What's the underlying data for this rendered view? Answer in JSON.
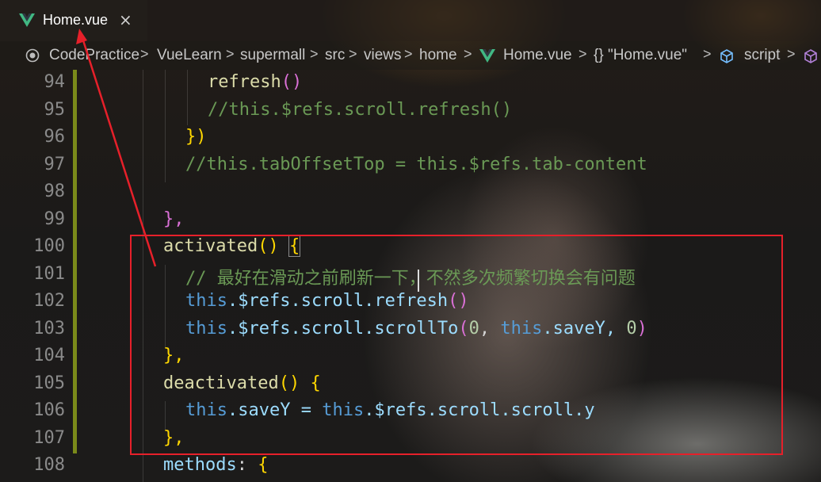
{
  "tab": {
    "name": "Home.vue",
    "close_glyph": "×",
    "icon": "vue-logo-icon"
  },
  "breadcrumb": {
    "items": [
      "CodePractice",
      "VueLearn",
      "supermall",
      "src",
      "views",
      "home",
      "Home.vue",
      "{} \"Home.vue\"",
      "script"
    ],
    "separator": ">"
  },
  "editor": {
    "lines": [
      {
        "n": "94"
      },
      {
        "n": "95"
      },
      {
        "n": "96"
      },
      {
        "n": "97"
      },
      {
        "n": "98"
      },
      {
        "n": "99"
      },
      {
        "n": "100"
      },
      {
        "n": "101"
      },
      {
        "n": "102"
      },
      {
        "n": "103"
      },
      {
        "n": "104"
      },
      {
        "n": "105"
      },
      {
        "n": "106"
      },
      {
        "n": "107"
      },
      {
        "n": "108"
      }
    ],
    "code": {
      "l94": "refresh",
      "l94p": "()",
      "l95": "//this.$refs.scroll.refresh()",
      "l96": "})",
      "l97": "//this.tabOffsetTop = this.$refs.tab-content",
      "l99": "},",
      "l100a": "activated",
      "l100b": "() ",
      "l100c": "{",
      "l101": "// 最好在滑动之前刷新一下，不然多次频繁切换会有问题",
      "l102a": "this",
      "l102b": ".$refs.scroll.refresh",
      "l102c": "()",
      "l103a": "this",
      "l103b": ".$refs.scroll.scrollTo",
      "l103c": "(",
      "l103d": "0",
      "l103e": ", ",
      "l103f": "this",
      "l103g": ".saveY, ",
      "l103h": "0",
      "l103i": ")",
      "l104": "},",
      "l105a": "deactivated",
      "l105b": "() ",
      "l105c": "{",
      "l106a": "this",
      "l106b": ".saveY = ",
      "l106c": "this",
      "l106d": ".$refs.scroll.scroll.y",
      "l107": "},",
      "l108a": "methods",
      "l108b": ": ",
      "l108c": "{"
    }
  },
  "colors": {
    "annotation": "#e6202a",
    "function": "#dcdcaa",
    "comment": "#6a9955",
    "keyword": "#569cd6",
    "variable": "#9cdcfe",
    "number": "#b5cea8"
  }
}
